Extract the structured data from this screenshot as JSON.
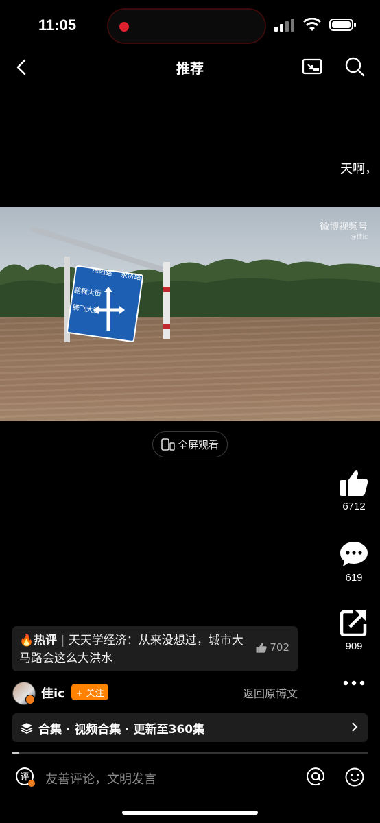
{
  "status": {
    "time": "11:05"
  },
  "header": {
    "title": "推荐"
  },
  "caption_peek": "天啊，",
  "video": {
    "watermark": "微博视频号",
    "watermark_sub": "@佳ic"
  },
  "fullscreen_label": "全屏观看",
  "actions": {
    "likes": "6712",
    "comments": "619",
    "shares": "909"
  },
  "hot_comment": {
    "tag": "热评",
    "text": "天天学经济：从来没想过，城市大马路会这么大洪水",
    "likes": "702"
  },
  "author": {
    "name": "佳ic",
    "follow_label": "+ 关注",
    "back_original": "返回原博文"
  },
  "collection": {
    "label": "合集 · 视频合集 · 更新至360集"
  },
  "comment_input": {
    "placeholder": "友善评论，文明发言"
  },
  "sign": {
    "road1": "华阳路",
    "road2": "永济路",
    "road3": "鹏程大街",
    "road4": "腾飞大街"
  }
}
